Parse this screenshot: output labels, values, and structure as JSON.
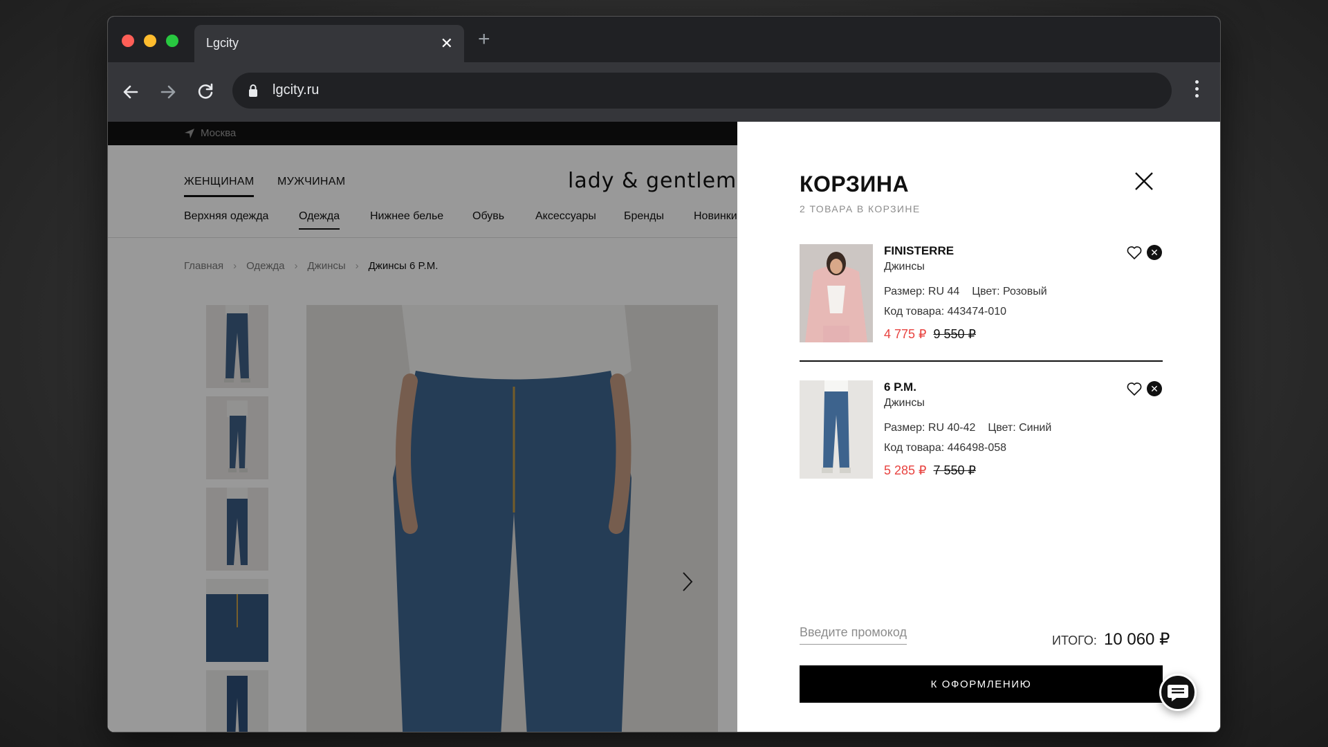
{
  "browser": {
    "tab_title": "Lgcity",
    "tab_close": "✕",
    "new_tab": "+",
    "url": "lgcity.ru"
  },
  "site": {
    "city": "Москва",
    "gender_tabs": [
      "ЖЕНЩИНАМ",
      "МУЖЧИНАМ"
    ],
    "logo": "lady & gentleman C",
    "categories": [
      "Верхняя одежда",
      "Одежда",
      "Нижнее белье",
      "Обувь",
      "Аксессуары",
      "Бренды",
      "Новинки"
    ],
    "breadcrumbs": [
      "Главная",
      "Одежда",
      "Джинсы",
      "Джинсы 6 P.M."
    ]
  },
  "cart": {
    "title": "КОРЗИНА",
    "count_text": "2 ТОВАРА В КОРЗИНЕ",
    "items": [
      {
        "brand": "FINISTERRE",
        "type": "Джинсы",
        "size": "Размер: RU 44",
        "color": "Цвет: Розовый",
        "code": "Код товара: 443474-010",
        "price_new": "4 775 ₽",
        "price_old": "9 550 ₽"
      },
      {
        "brand": "6 P.M.",
        "type": "Джинсы",
        "size": "Размер: RU 40-42",
        "color": "Цвет: Синий",
        "code": "Код товара: 446498-058",
        "price_new": "5 285 ₽",
        "price_old": "7 550 ₽"
      }
    ],
    "promo_placeholder": "Введите промокод",
    "total_label": "ИТОГО:",
    "total_value": "10 060 ₽",
    "checkout_label": "К ОФОРМЛЕНИЮ"
  },
  "colors": {
    "sale_price": "#e8423f",
    "button": "#000000",
    "browser_dark": "#202124"
  }
}
